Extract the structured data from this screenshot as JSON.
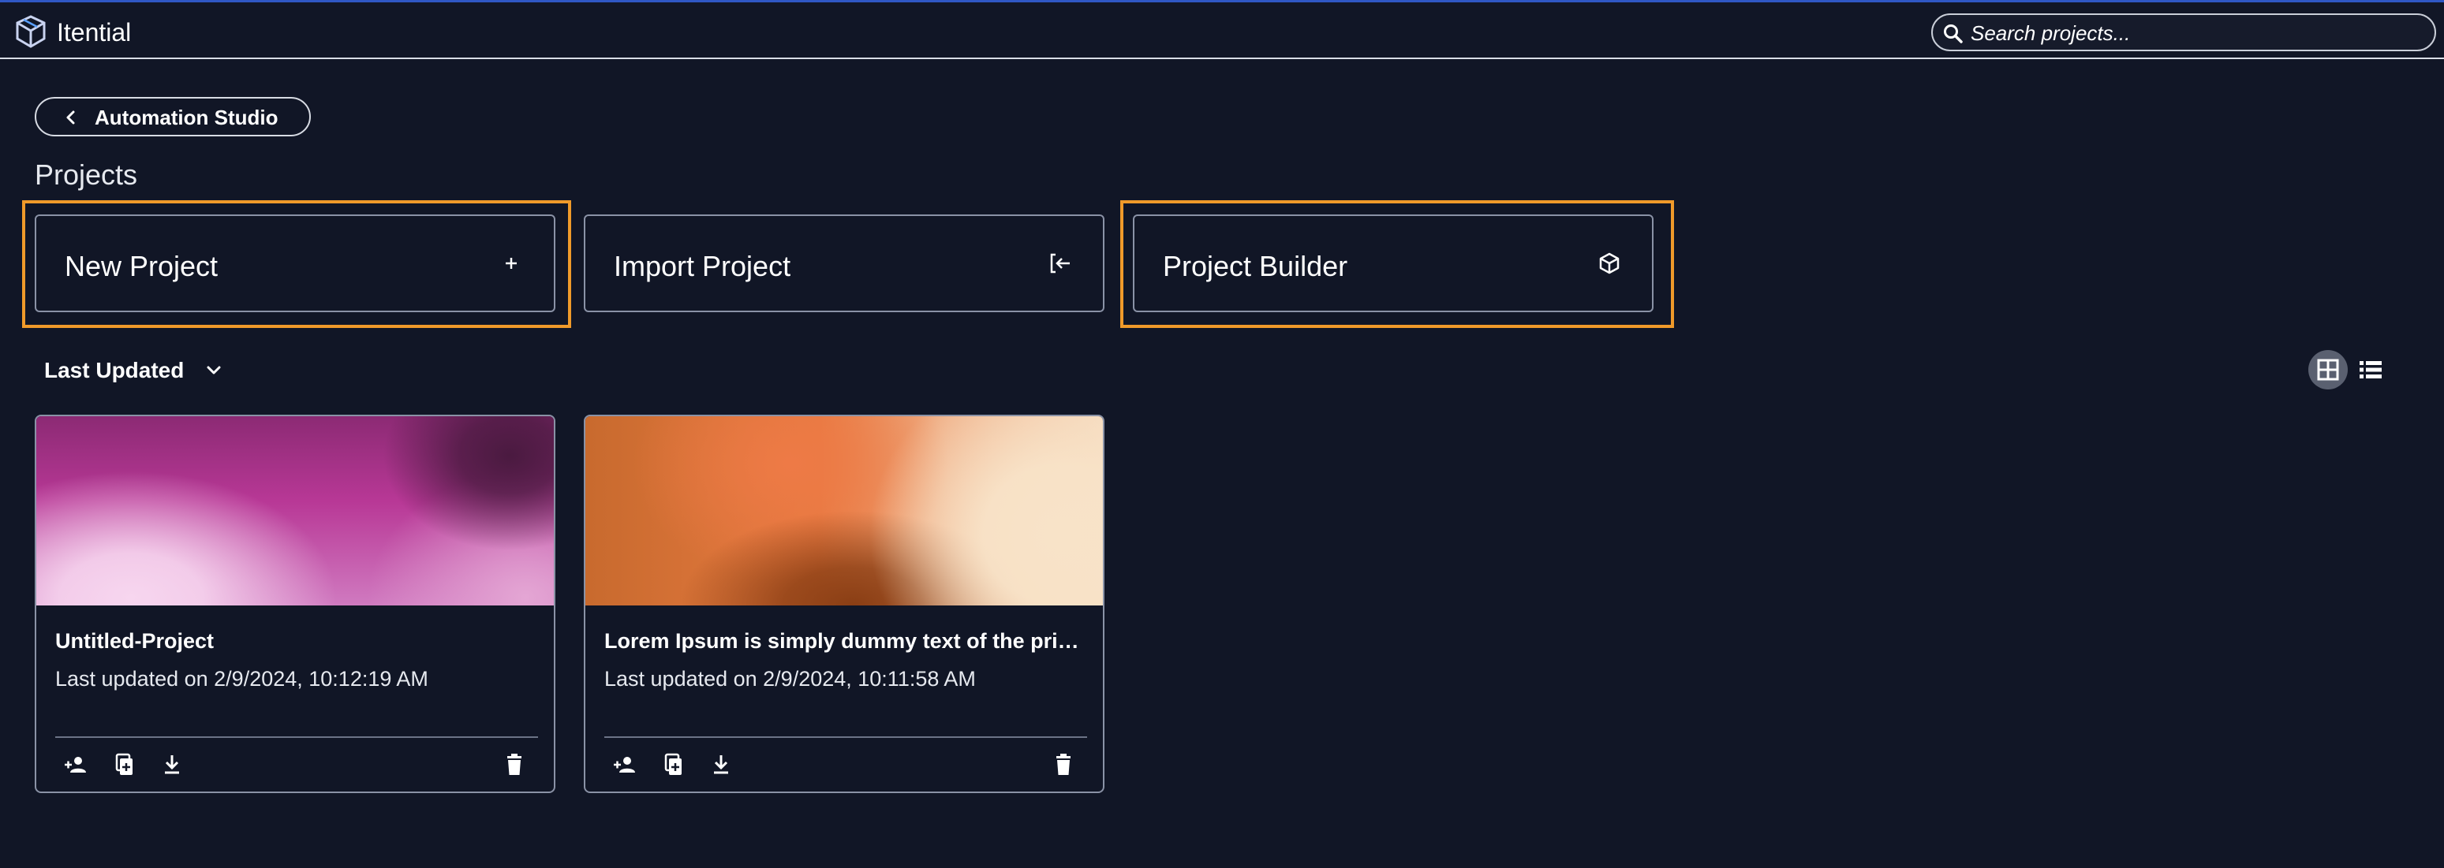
{
  "header": {
    "app_name": "Itential",
    "search_placeholder": "Search projects..."
  },
  "breadcrumb": {
    "back_label": "Automation Studio"
  },
  "page": {
    "title": "Projects"
  },
  "actions": [
    {
      "label": "New Project",
      "icon": "plus-icon"
    },
    {
      "label": "Import Project",
      "icon": "import-icon"
    },
    {
      "label": "Project Builder",
      "icon": "cube-icon"
    }
  ],
  "sort": {
    "label": "Last Updated"
  },
  "view_modes": [
    "grid-view-icon",
    "list-view-icon"
  ],
  "projects": [
    {
      "name": "Untitled-Project",
      "updated": "Last updated on 2/9/2024, 10:12:19 AM",
      "thumbnail": "pink-gradient"
    },
    {
      "name": "Lorem Ipsum is simply dummy text of the printing and typesetting industry",
      "updated": "Last updated on 2/9/2024, 10:11:58 AM",
      "thumbnail": "orange-gradient"
    }
  ],
  "card_actions": [
    "add-member-icon",
    "copy-icon",
    "download-icon",
    "delete-icon"
  ],
  "colors": {
    "background": "#111626",
    "highlight": "#f09a2a",
    "accent_line": "#2f57c4",
    "border": "#8a92a6"
  }
}
